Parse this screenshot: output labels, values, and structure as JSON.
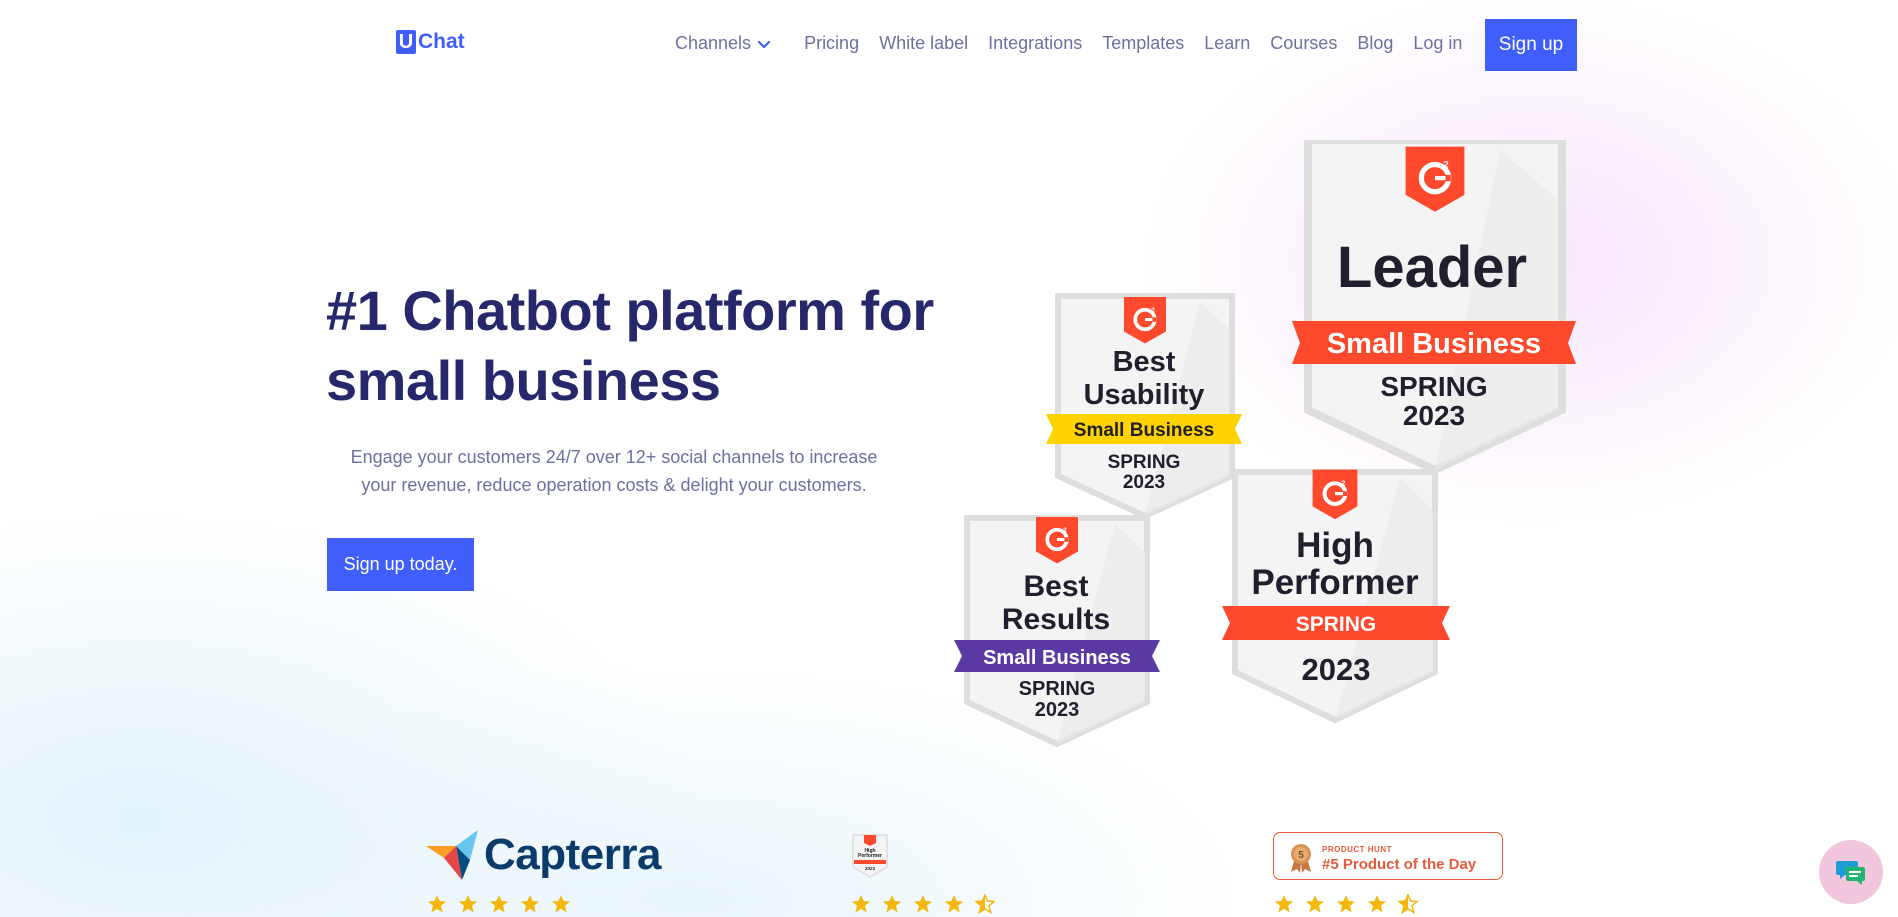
{
  "brand": {
    "logo_letter": "U",
    "logo_name": "Chat",
    "accent": "#3f5efb"
  },
  "nav": {
    "items": [
      "Channels",
      "Pricing",
      "White label",
      "Integrations",
      "Templates",
      "Learn",
      "Courses",
      "Blog",
      "Log in"
    ],
    "signup_label": "Sign up"
  },
  "hero": {
    "title": "#1 Chatbot platform for small business",
    "subtitle_line1": "Engage your customers 24/7 over 12+ social channels to increase",
    "subtitle_line2": "your revenue, reduce operation costs & delight your customers.",
    "cta_label": "Sign up today."
  },
  "badges": [
    {
      "title_lines": [
        "Leader"
      ],
      "ribbon": "Small Business",
      "season": "SPRING",
      "year": "2023",
      "ribbon_color": "#ff492c"
    },
    {
      "title_lines": [
        "Best",
        "Usability"
      ],
      "ribbon": "Small Business",
      "season": "SPRING",
      "year": "2023",
      "ribbon_color": "#ffd200"
    },
    {
      "title_lines": [
        "Best",
        "Results"
      ],
      "ribbon": "Small Business",
      "season": "SPRING",
      "year": "2023",
      "ribbon_color": "#5a39a2"
    },
    {
      "title_lines": [
        "High",
        "Performer"
      ],
      "ribbon": "SPRING",
      "season": "",
      "year": "2023",
      "ribbon_color": "#ff492c"
    }
  ],
  "reviews": {
    "capterra_name": "Capterra",
    "capterra_stars": 5,
    "g2_stars": 4.5,
    "g2_mini_lines": [
      "High",
      "Performer",
      "2023"
    ],
    "producthunt_label": "PRODUCT HUNT",
    "producthunt_award": "#5 Product of the Day",
    "producthunt_rank": "5",
    "producthunt_stars": 4.5
  },
  "icons": {
    "chevron": "chevron-down-icon",
    "chat": "chat-bubble-icon",
    "star": "star-icon"
  }
}
